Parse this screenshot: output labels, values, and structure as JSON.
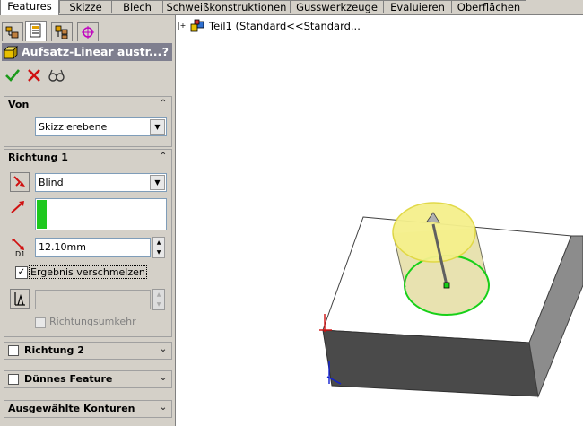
{
  "tabs": [
    {
      "label": "Features",
      "active": true
    },
    {
      "label": "Skizze",
      "active": false
    },
    {
      "label": "Blech",
      "active": false
    },
    {
      "label": "Schweißkonstruktionen",
      "active": false
    },
    {
      "label": "Gusswerkzeuge",
      "active": false
    },
    {
      "label": "Evaluieren",
      "active": false
    },
    {
      "label": "Oberflächen",
      "active": false
    }
  ],
  "manager_tabs": [
    "feature-manager-icon",
    "property-manager-icon",
    "configuration-manager-icon",
    "dimxpert-manager-icon"
  ],
  "property_manager": {
    "title": "Aufsatz-Linear austr...",
    "help": "?",
    "actions": [
      "ok-icon",
      "cancel-icon",
      "preview-icon"
    ]
  },
  "von": {
    "header": "Von",
    "start_condition": "Skizzierebene"
  },
  "richtung1": {
    "header": "Richtung 1",
    "end_condition": "Blind",
    "depth": "12.10mm",
    "merge_label": "Ergebnis verschmelzen",
    "merge_checked": true,
    "draft_value": "",
    "reverse_label": "Richtungsumkehr",
    "reverse_checked": false
  },
  "collapsed_groups": [
    {
      "label": "Richtung 2",
      "checkbox": true
    },
    {
      "label": "Dünnes Feature",
      "checkbox": true
    },
    {
      "label": "Ausgewählte Konturen",
      "checkbox": false
    }
  ],
  "tree": {
    "expander": "+",
    "label": "Teil1  (Standard<<Standard..."
  },
  "colors": {
    "accent_green": "#00c000",
    "preview_yellow": "#f5f08c",
    "face_dark": "#4a4a4a",
    "face_side": "#8c8c8c"
  }
}
